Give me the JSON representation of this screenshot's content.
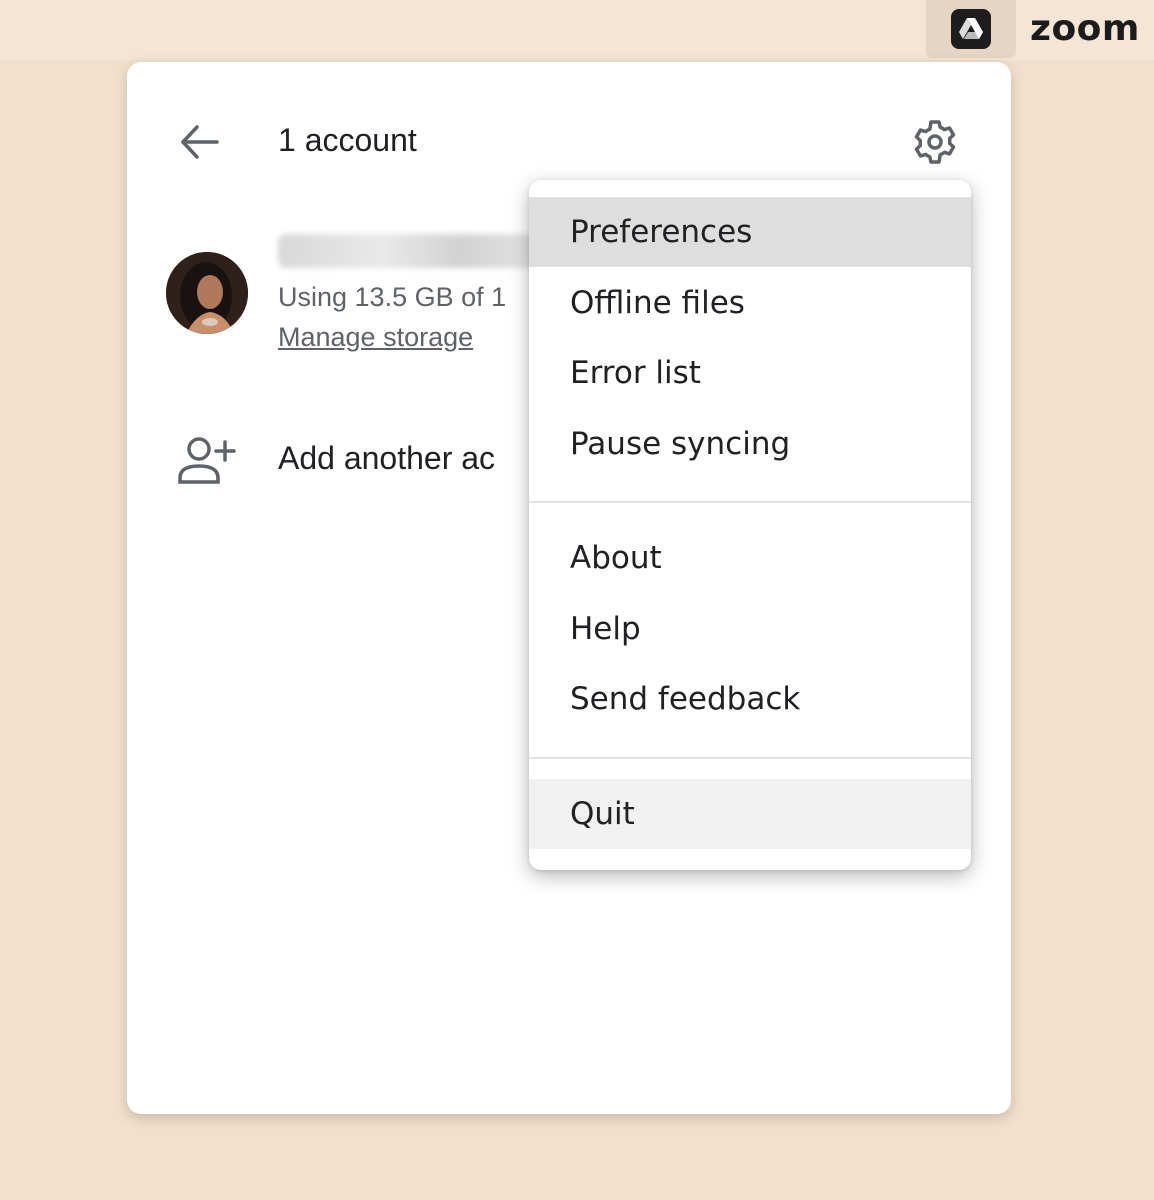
{
  "menubar": {
    "drive_icon": "google-drive-icon",
    "zoom_label": "zoom"
  },
  "panel": {
    "title": "1 account",
    "back_icon": "arrow-left-icon",
    "settings_icon": "gear-icon"
  },
  "account": {
    "storage_text": "Using 13.5 GB of 1",
    "manage_storage": "Manage storage",
    "add_account": "Add another ac",
    "add_account_icon": "person-add-icon"
  },
  "menu": {
    "items": [
      {
        "label": "Preferences"
      },
      {
        "label": "Offline files"
      },
      {
        "label": "Error list"
      },
      {
        "label": "Pause syncing"
      },
      {
        "label": "About"
      },
      {
        "label": "Help"
      },
      {
        "label": "Send feedback"
      },
      {
        "label": "Quit"
      }
    ],
    "highlighted": "Preferences",
    "hovered": "Quit"
  },
  "colors": {
    "background": "#f3e0cc",
    "panel": "#ffffff",
    "text_primary": "#202124",
    "text_secondary": "#5f6368",
    "highlight": "#dedede"
  }
}
